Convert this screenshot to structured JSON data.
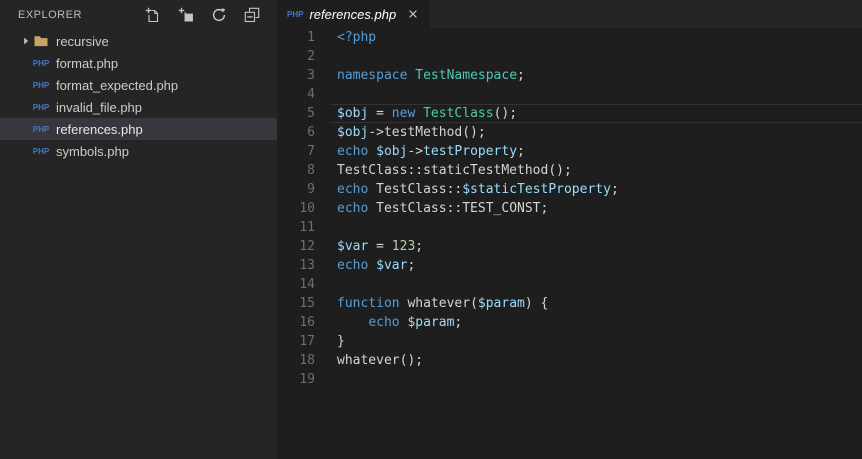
{
  "colors": {
    "sidebar_bg": "#252526",
    "editor_bg": "#1e1e1e",
    "selected_row_bg": "#37373d",
    "current_line_border": "#323232",
    "php_icon_blue": "#4079c9",
    "folder_icon_tan": "#c8a46a",
    "keyword": "#569cd6",
    "class_name": "#4ec9b0",
    "variable": "#9cdcfe",
    "plain_text": "#d4d4d4",
    "number": "#b5cea8",
    "line_number": "#6e6e6e"
  },
  "explorer": {
    "title": "EXPLORER",
    "actions": [
      {
        "icon": "new-file-icon"
      },
      {
        "icon": "new-folder-icon"
      },
      {
        "icon": "refresh-icon"
      },
      {
        "icon": "collapse-all-icon"
      }
    ],
    "tree": [
      {
        "type": "folder",
        "label": "recursive",
        "collapsed": true,
        "selected": false
      },
      {
        "type": "file",
        "badge": "PHP",
        "label": "format.php",
        "selected": false
      },
      {
        "type": "file",
        "badge": "PHP",
        "label": "format_expected.php",
        "selected": false
      },
      {
        "type": "file",
        "badge": "PHP",
        "label": "invalid_file.php",
        "selected": false
      },
      {
        "type": "file",
        "badge": "PHP",
        "label": "references.php",
        "selected": true
      },
      {
        "type": "file",
        "badge": "PHP",
        "label": "symbols.php",
        "selected": false
      }
    ]
  },
  "editor": {
    "tab": {
      "badge": "PHP",
      "label": "references.php",
      "preview": true,
      "active": true,
      "close_icon": "close-icon"
    },
    "lines": [
      {
        "num": 1,
        "current": false,
        "tokens": [
          [
            "<?php",
            "k"
          ]
        ]
      },
      {
        "num": 2,
        "current": false,
        "tokens": []
      },
      {
        "num": 3,
        "current": false,
        "tokens": [
          [
            "namespace ",
            "k"
          ],
          [
            "TestNamespace",
            "c"
          ],
          [
            ";",
            "p"
          ]
        ]
      },
      {
        "num": 4,
        "current": false,
        "tokens": []
      },
      {
        "num": 5,
        "current": true,
        "tokens": [
          [
            "$obj",
            "v"
          ],
          [
            " = ",
            "p"
          ],
          [
            "new ",
            "k"
          ],
          [
            "TestClass",
            "c"
          ],
          [
            "();",
            "p"
          ]
        ]
      },
      {
        "num": 6,
        "current": false,
        "tokens": [
          [
            "$obj",
            "v"
          ],
          [
            "->testMethod();",
            "p"
          ]
        ]
      },
      {
        "num": 7,
        "current": false,
        "tokens": [
          [
            "echo ",
            "k"
          ],
          [
            "$obj",
            "v"
          ],
          [
            "->",
            "p"
          ],
          [
            "testProperty",
            "v"
          ],
          [
            ";",
            "p"
          ]
        ]
      },
      {
        "num": 8,
        "current": false,
        "tokens": [
          [
            "TestClass::staticTestMethod();",
            "p"
          ]
        ]
      },
      {
        "num": 9,
        "current": false,
        "tokens": [
          [
            "echo ",
            "k"
          ],
          [
            "TestClass::",
            "p"
          ],
          [
            "$staticTestProperty",
            "v"
          ],
          [
            ";",
            "p"
          ]
        ]
      },
      {
        "num": 10,
        "current": false,
        "tokens": [
          [
            "echo ",
            "k"
          ],
          [
            "TestClass::TEST_CONST;",
            "p"
          ]
        ]
      },
      {
        "num": 11,
        "current": false,
        "tokens": []
      },
      {
        "num": 12,
        "current": false,
        "tokens": [
          [
            "$var",
            "v"
          ],
          [
            " = ",
            "p"
          ],
          [
            "123",
            "n"
          ],
          [
            ";",
            "p"
          ]
        ]
      },
      {
        "num": 13,
        "current": false,
        "tokens": [
          [
            "echo ",
            "k"
          ],
          [
            "$var",
            "v"
          ],
          [
            ";",
            "p"
          ]
        ]
      },
      {
        "num": 14,
        "current": false,
        "tokens": []
      },
      {
        "num": 15,
        "current": false,
        "tokens": [
          [
            "function ",
            "k"
          ],
          [
            "whatever(",
            "p"
          ],
          [
            "$param",
            "v"
          ],
          [
            ") {",
            "p"
          ]
        ]
      },
      {
        "num": 16,
        "current": false,
        "tokens": [
          [
            "    ",
            "p"
          ],
          [
            "echo ",
            "k"
          ],
          [
            "$param",
            "v"
          ],
          [
            ";",
            "p"
          ]
        ]
      },
      {
        "num": 17,
        "current": false,
        "tokens": [
          [
            "}",
            "p"
          ]
        ]
      },
      {
        "num": 18,
        "current": false,
        "tokens": [
          [
            "whatever();",
            "p"
          ]
        ]
      },
      {
        "num": 19,
        "current": false,
        "tokens": []
      }
    ]
  }
}
